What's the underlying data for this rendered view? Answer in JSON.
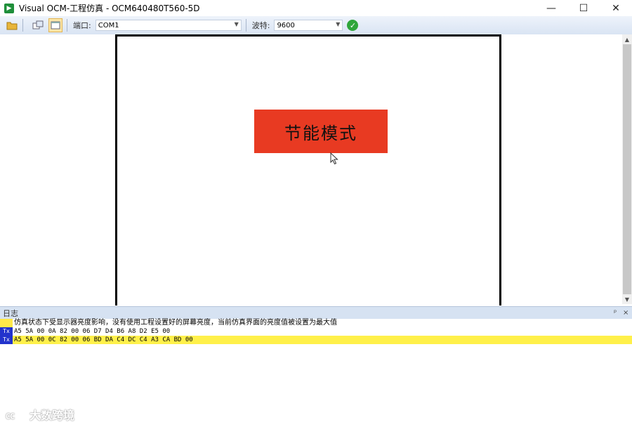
{
  "window": {
    "title": "Visual OCM-工程仿真 - OCM640480T560-5D",
    "minimize": "—",
    "maximize": "☐",
    "close": "✕"
  },
  "toolbar": {
    "port_label": "端口:",
    "port_value": "COM1",
    "baud_label": "波特:",
    "baud_value": "9600"
  },
  "canvas": {
    "mode_button_label": "节能模式",
    "mode_button_color": "#e83a22"
  },
  "log": {
    "title": "日志",
    "pin_label": "ᵖ",
    "close_label": "×",
    "rows": [
      {
        "tag": "",
        "text": "仿真状态下受显示器亮度影响，没有使用工程设置好的屏幕亮度，当前仿真界面的亮度值被设置为最大值"
      },
      {
        "tag": "Tx",
        "text": "A5 5A 00 0A 82 00 06 D7 D4 B6 A8 D2 E5 00"
      },
      {
        "tag": "Tx",
        "text": "A5 5A 00 0C 82 00 06 BD DA C4 DC C4 A3 CA BD 00"
      }
    ]
  },
  "watermark": {
    "logo": "㏄",
    "text": "大数跨境"
  }
}
